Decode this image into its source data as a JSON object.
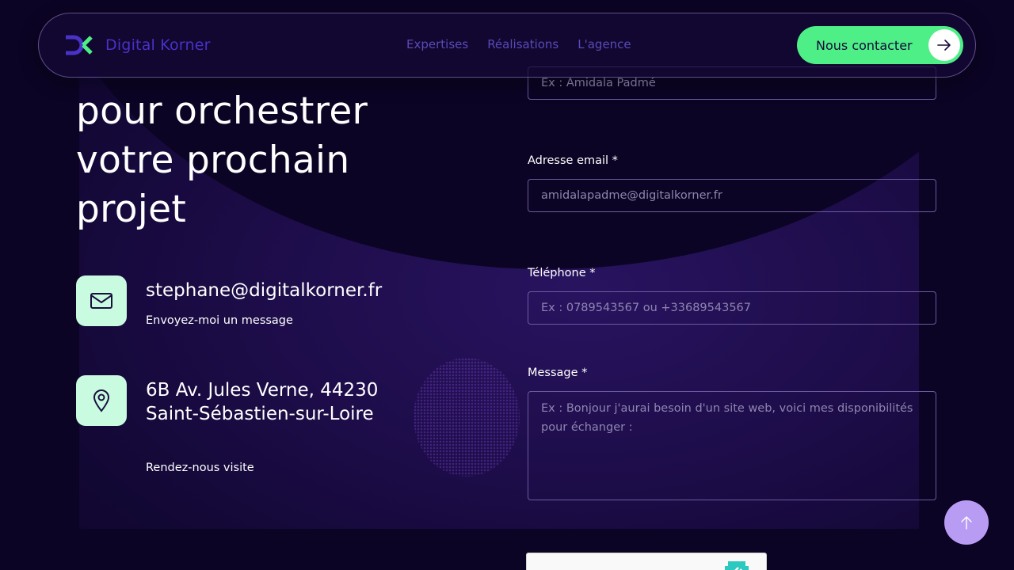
{
  "header": {
    "logo_text": "Digital Korner",
    "nav": [
      {
        "label": "Expertises"
      },
      {
        "label": "Réalisations"
      },
      {
        "label": "L'agence"
      }
    ],
    "cta_label": "Nous contacter"
  },
  "hero": {
    "heading_lines": [
      "pour orchestrer",
      "votre prochain",
      "projet"
    ]
  },
  "contact": {
    "email": {
      "icon": "mail-icon",
      "value": "stephane@digitalkorner.fr",
      "caption": "Envoyez-moi un message"
    },
    "address": {
      "icon": "map-pin-icon",
      "value": "6B Av. Jules Verne, 44230 Saint-Sébastien-sur-Loire",
      "caption": "Rendez-nous visite"
    }
  },
  "form": {
    "name": {
      "placeholder": "Ex : Amidala Padmé"
    },
    "email": {
      "label": "Adresse email *",
      "placeholder": "amidalapadme@digitalkorner.fr"
    },
    "phone": {
      "label": "Téléphone *",
      "placeholder": "Ex : 0789543567 ou +33689543567"
    },
    "message": {
      "label": "Message *",
      "placeholder": "Ex : Bonjour j'aurai besoin d'un site web, voici mes disponibilités pour échanger :"
    }
  },
  "colors": {
    "accent_green": "#4eef86",
    "icon_tile": "#c9fbe0",
    "brand_purple": "#4a31c8",
    "scroll_button": "#b89cf3"
  }
}
